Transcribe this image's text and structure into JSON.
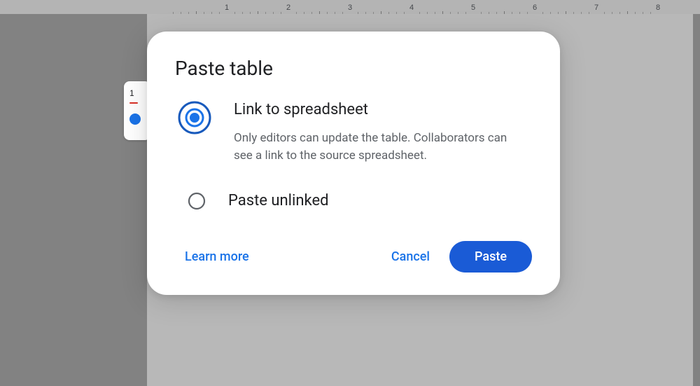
{
  "ruler": {
    "marks": [
      1,
      2,
      3,
      4,
      5,
      6,
      7,
      8
    ]
  },
  "dialog": {
    "title": "Paste table",
    "options": {
      "link": {
        "label": "Link to spreadsheet",
        "description": "Only editors can update the table. Collaborators can see a link to the source spreadsheet.",
        "selected": true
      },
      "unlinked": {
        "label": "Paste unlinked",
        "selected": false
      }
    },
    "actions": {
      "learn_more": "Learn more",
      "cancel": "Cancel",
      "confirm": "Paste"
    }
  }
}
